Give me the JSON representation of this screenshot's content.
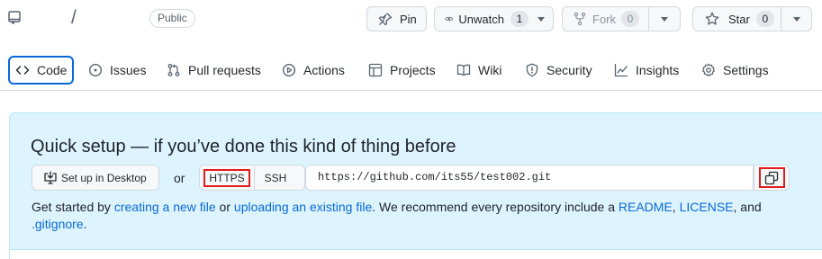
{
  "repo": {
    "separator": "/",
    "visibility": "Public"
  },
  "actions": {
    "pin_label": "Pin",
    "watch_label": "Unwatch",
    "watch_count": "1",
    "fork_label": "Fork",
    "fork_count": "0",
    "star_label": "Star",
    "star_count": "0"
  },
  "tabs": [
    {
      "label": "Code",
      "icon": "code-icon",
      "selected": true
    },
    {
      "label": "Issues",
      "icon": "issue-icon"
    },
    {
      "label": "Pull requests",
      "icon": "pull-request-icon"
    },
    {
      "label": "Actions",
      "icon": "play-icon"
    },
    {
      "label": "Projects",
      "icon": "table-icon"
    },
    {
      "label": "Wiki",
      "icon": "book-icon"
    },
    {
      "label": "Security",
      "icon": "shield-icon"
    },
    {
      "label": "Insights",
      "icon": "graph-icon"
    },
    {
      "label": "Settings",
      "icon": "gear-icon"
    }
  ],
  "quick_setup": {
    "title": "Quick setup — if you’ve done this kind of thing before",
    "desktop_label": "Set up in Desktop",
    "or_label": "or",
    "https_label": "HTTPS",
    "ssh_label": "SSH",
    "clone_url": "https://github.com/its55/test002.git",
    "desc": {
      "part1": "Get started by ",
      "link1": "creating a new file",
      "part2": " or ",
      "link2": "uploading an existing file",
      "part3": ". We recommend every repository include a ",
      "link3": "README",
      "part4": ", ",
      "link4": "LICENSE",
      "part5": ", and ",
      "link5": ".gitignore",
      "part6": "."
    }
  },
  "colors": {
    "accent": "#0969da",
    "highlight": "#e11d1d",
    "setup_bg": "#ddf4ff"
  }
}
